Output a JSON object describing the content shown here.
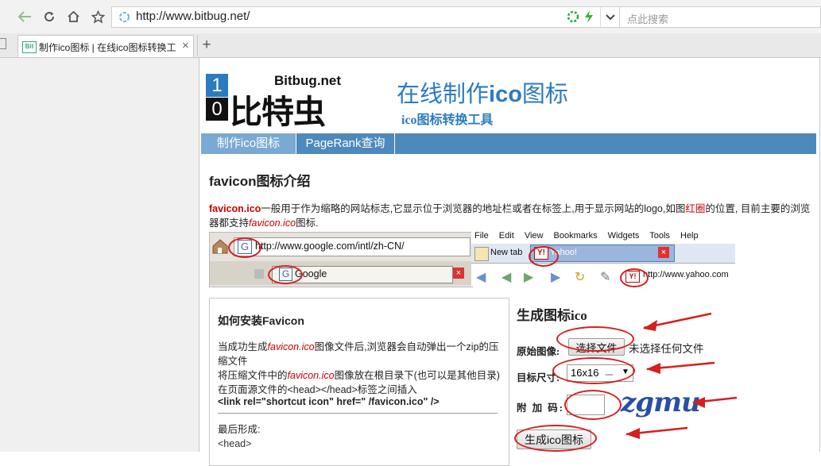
{
  "browser": {
    "url_host": "http://www.bitbug.net/",
    "search_placeholder": "点此搜索",
    "tab_title": "制作ico图标 | 在线ico图标转换工",
    "tab_favicon": "Bit",
    "new_tab_symbol": "+",
    "close_symbol": "×"
  },
  "site": {
    "logo_digits": [
      "1",
      "0"
    ],
    "logo_en": "Bitbug.net",
    "logo_cn": "比特虫",
    "title_prefix": "在线制作",
    "title_ico": "ico",
    "title_suffix": "图标",
    "subtitle": "ico图标转换工具",
    "nav": [
      "制作ico图标",
      "PageRank查询"
    ]
  },
  "intro": {
    "heading": "favicon图标介绍",
    "p_lead": "favicon.ico",
    "p_mid": "一般用于作为缩略的网站标志,它显示位于浏览器的地址栏或者在标签上,用于显示网站的logo,如图",
    "p_red": "红圈",
    "p_tail": "的位置,  目前主要的浏览器都支持",
    "p_italic": "favicon.ico",
    "p_end": "图标."
  },
  "screenshot_left": {
    "url": "http://www.google.com/intl/zh-CN/",
    "tab_label": "Google"
  },
  "screenshot_right": {
    "menu": [
      "File",
      "Edit",
      "View",
      "Bookmarks",
      "Widgets",
      "Tools",
      "Help"
    ],
    "tab_new": "New tab",
    "tab_yahoo": "Yahoo!",
    "url": "http://www.yahoo.com"
  },
  "install": {
    "heading": "如何安装Favicon",
    "l1a": "当成功生成",
    "l1b": "favicon.ico",
    "l1c": "图像文件后,浏览器会自动弹出一个zip的压缩文件",
    "l2a": "将压缩文件中的",
    "l2b": "favicon.ico",
    "l2c": "图像放在根目录下(也可以是其他目录)",
    "l3": "在页面源文件的<head></head>标签之间插入",
    "code": "<link rel=\"shortcut icon\" href=\" /favicon.ico\" />",
    "final_label": "最后形成:",
    "final_code": "<head>"
  },
  "generator": {
    "heading": "生成图标ico",
    "src_label": "原始图像:",
    "choose_button": "选择文件",
    "no_file": "未选择任何文件",
    "size_label": "目标尺寸:",
    "size_value": "16x16",
    "size_suffix": "－",
    "captcha_label": "附 加 码:",
    "captcha_value": "",
    "captcha_image_text": "zgmu",
    "submit": "生成ico图标"
  },
  "colors": {
    "accent": "#2b7bc0",
    "nav_bg": "#4e89bc",
    "annotation": "#d61f1f"
  }
}
